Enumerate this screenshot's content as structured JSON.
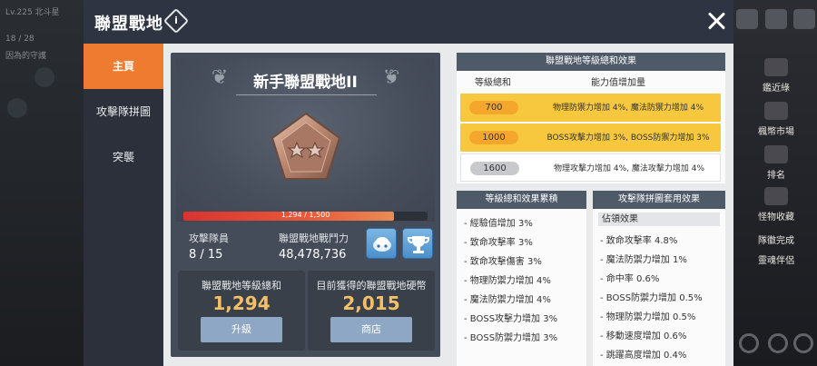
{
  "dialog": {
    "title": "聯盟戰地",
    "info_icon_glyph": "i",
    "close_icon": "close-icon"
  },
  "sidebar": {
    "tabs": [
      {
        "label": "主頁",
        "active": true
      },
      {
        "label": "攻擊隊拼圖",
        "active": false
      },
      {
        "label": "突襲",
        "active": false
      }
    ]
  },
  "hero": {
    "title": "新手聯盟戰地II",
    "emblem_icon": "pentagon-two-stars-emblem-icon",
    "progress_text": "1,294 / 1,500",
    "progress_fraction": 0.8627
  },
  "stats": {
    "team_label": "攻擊隊員",
    "team_value": "8 / 15",
    "power_label": "聯盟戰地戰鬥力",
    "power_value": "48,478,736"
  },
  "cards": {
    "level_label": "聯盟戰地等級總和",
    "level_value": "1,294",
    "level_button": "升級",
    "coin_label": "目前獲得的聯盟戰地硬幣",
    "coin_value": "2,015",
    "coin_button": "商店"
  },
  "effects": {
    "header": "聯盟戰地等級總和效果",
    "col_level": "等級總和",
    "col_ability": "能力值增加量",
    "rows": [
      {
        "level": "700",
        "text": "物理防禦力增加 4%, 魔法防禦力增加 4%",
        "highlight": true
      },
      {
        "level": "1000",
        "text": "BOSS攻擊力增加 3%, BOSS防禦力增加 3%",
        "highlight": true
      },
      {
        "level": "1600",
        "text": "物理攻擊力增加 4%, 魔法攻擊力增加 4%",
        "highlight": false
      }
    ]
  },
  "accumulated": {
    "header": "等級總和效果累積",
    "items": [
      "- 經驗值增加 3%",
      "- 致命攻擊率 3%",
      "- 致命攻擊傷害 3%",
      "- 物理防禦力增加 4%",
      "- 魔法防禦力增加 4%",
      "- BOSS攻擊力增加 3%",
      "- BOSS防禦力增加 3%"
    ]
  },
  "puzzle": {
    "header": "攻擊隊拼圖套用效果",
    "subheader": "佔領效果",
    "items": [
      "- 致命攻擊率 4.8%",
      "- 魔法防禦力增加 1%",
      "- 命中率 0.6%",
      "- BOSS防禦力增加 0.5%",
      "- 物理防禦力增加 0.5%",
      "- 移動速度增加 0.6%",
      "- 跳躍高度增加 0.4%"
    ]
  },
  "background": {
    "left_hud": [
      "Lv.225 北斗星",
      "18 / 28",
      "因為的守護"
    ],
    "right_menu": [
      "鑑近綠",
      "楓幣市場",
      "排名",
      "怪物收藏",
      "隊徽完成",
      "靈魂伴侶"
    ]
  },
  "colors": {
    "header_bg": "#2e3441",
    "accent_orange": "#ef7b30",
    "highlight_yellow": "#f7c83d",
    "value_gold": "#f4c067"
  }
}
